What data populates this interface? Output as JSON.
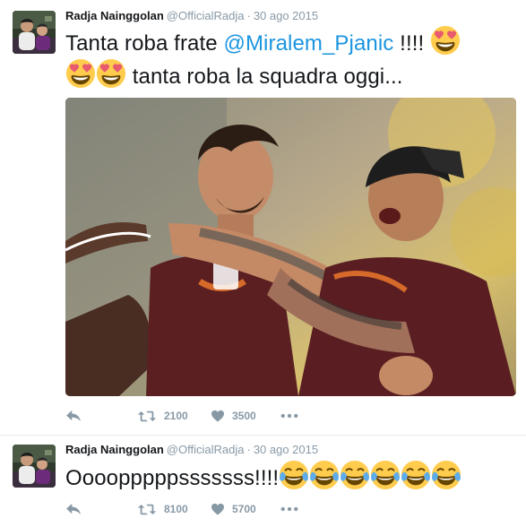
{
  "tweets": [
    {
      "author_name": "Radja Nainggolan",
      "author_handle": "@OfficialRadja",
      "separator": "·",
      "date": "30 ago 2015",
      "text_before": "Tanta roba frate ",
      "mention": "@Miralem_Pjanic",
      "text_after_mention": " !!!!",
      "text_line2": " tanta roba la squadra oggi...",
      "emojis_line1": [
        "heart-eyes-emoji"
      ],
      "emojis_line2": [
        "heart-eyes-emoji",
        "heart-eyes-emoji"
      ],
      "retweet_count": "2100",
      "like_count": "3500"
    },
    {
      "author_name": "Radja Nainggolan",
      "author_handle": "@OfficialRadja",
      "separator": "·",
      "date": "30 ago 2015",
      "text": "Oooopppppsssssss!!!!",
      "emojis": [
        "tears-of-joy-emoji",
        "tears-of-joy-emoji",
        "tears-of-joy-emoji",
        "tears-of-joy-emoji",
        "tears-of-joy-emoji",
        "tears-of-joy-emoji"
      ],
      "retweet_count": "8100",
      "like_count": "5700"
    }
  ],
  "colors": {
    "mention": "#1b95e0",
    "muted": "#8899a6",
    "text": "#14171a",
    "divider": "#e6ecf0"
  }
}
